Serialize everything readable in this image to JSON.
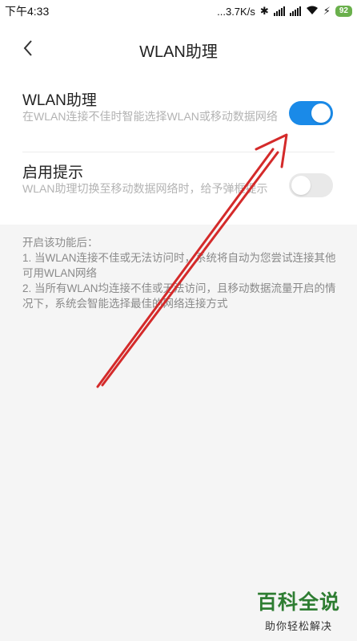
{
  "status_bar": {
    "time": "下午4:33",
    "network_speed": "...3.7K/s",
    "battery": "92"
  },
  "header": {
    "title": "WLAN助理"
  },
  "settings": [
    {
      "title": "WLAN助理",
      "description": "在WLAN连接不佳时智能选择WLAN或移动数据网络",
      "enabled": true
    },
    {
      "title": "启用提示",
      "description": "WLAN助理切换至移动数据网络时，给予弹框提示",
      "enabled": false
    }
  ],
  "note": {
    "heading": "开启该功能后：",
    "line1": "1. 当WLAN连接不佳或无法访问时，系统将自动为您尝试连接其他可用WLAN网络",
    "line2": "2. 当所有WLAN均连接不佳或无法访问，且移动数据流量开启的情况下，系统会智能选择最佳的网络连接方式"
  },
  "watermark": {
    "title": "百科全说",
    "subtitle": "助你轻松解决"
  },
  "colors": {
    "accent": "#1a8ae8",
    "annotation_arrow": "#d42a2a",
    "watermark": "#2e7d32"
  }
}
